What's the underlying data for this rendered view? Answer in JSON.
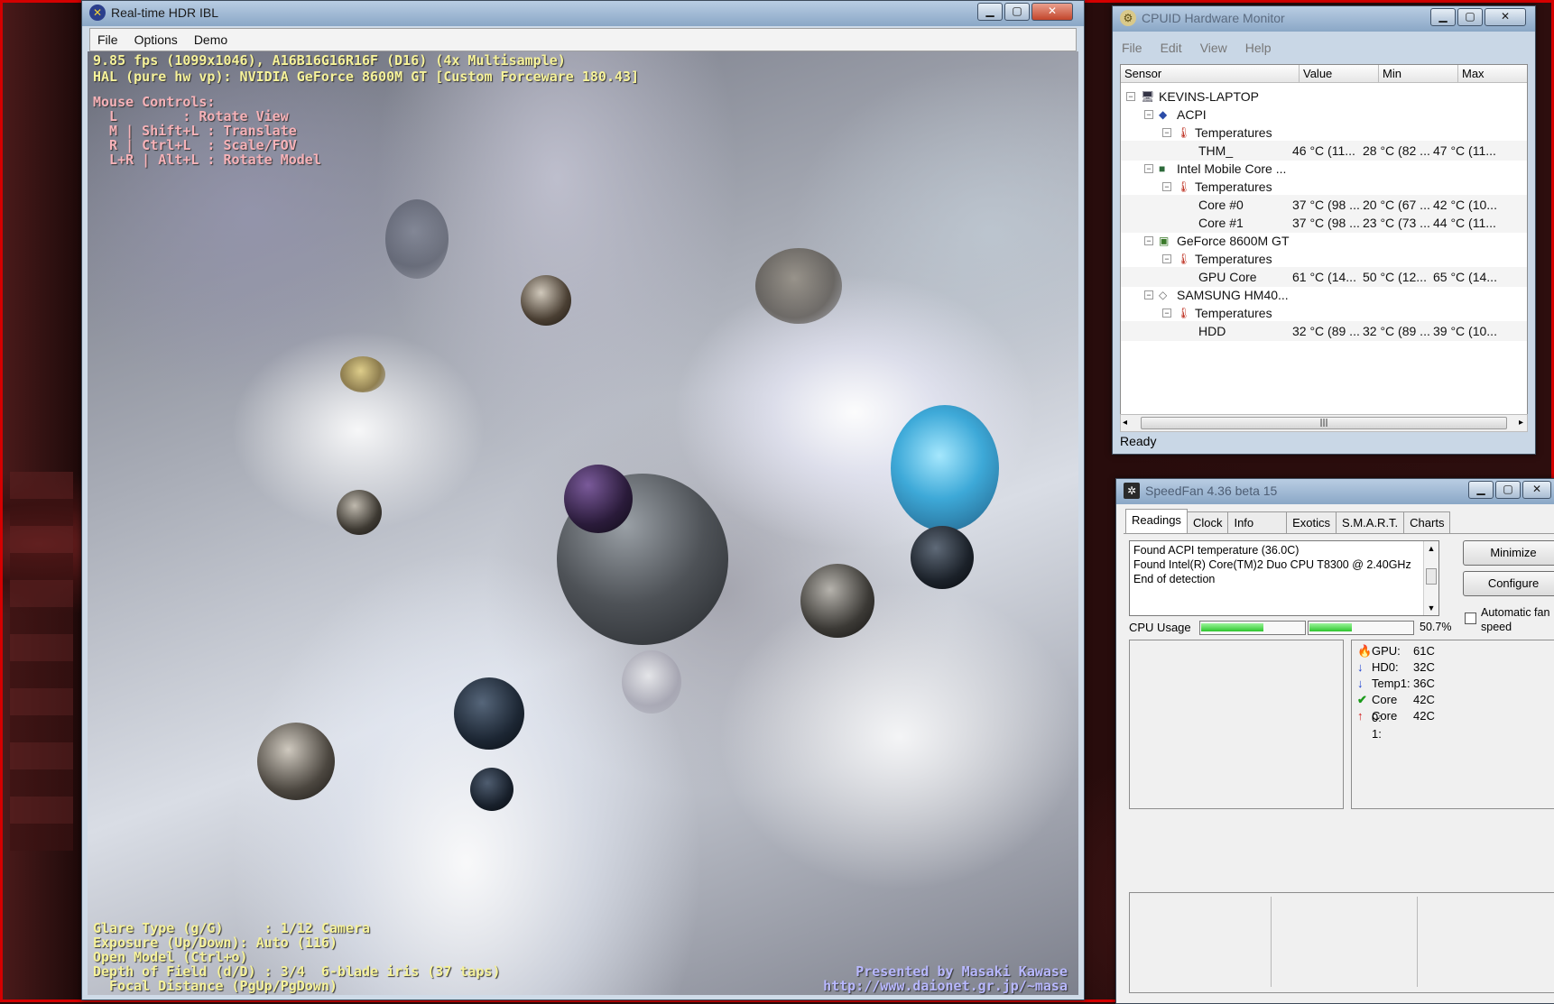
{
  "hdr": {
    "title": "Real-time HDR IBL",
    "menu": [
      "File",
      "Options",
      "Demo"
    ],
    "overlay_top": [
      "9.85 fps (1099x1046), A16B16G16R16F (D16) (4x Multisample)",
      "HAL (pure hw vp): NVIDIA GeForce 8600M GT [Custom Forceware 180.43]"
    ],
    "mouse_controls": [
      "Mouse Controls:",
      "  L        : Rotate View",
      "  M | Shift+L : Translate",
      "  R | Ctrl+L  : Scale/FOV",
      "  L+R | Alt+L : Rotate Model"
    ],
    "overlay_bottom": [
      "Glare Type (g/G)     : 1/12 Camera",
      "Exposure (Up/Down): Auto (116)",
      "Open Model (Ctrl+o)",
      "Depth of Field (d/D) : 3/4  6-blade iris (37 taps)",
      "  Focal Distance (PgUp/PgDown)"
    ],
    "credit": [
      "Presented by Masaki Kawase",
      "http://www.daionet.gr.jp/~masa"
    ]
  },
  "cpuid": {
    "title": "CPUID Hardware Monitor",
    "menu": [
      "File",
      "Edit",
      "View",
      "Help"
    ],
    "columns": [
      "Sensor",
      "Value",
      "Min",
      "Max"
    ],
    "rows": [
      {
        "level": 0,
        "toggle": "-",
        "icon": "computer-icon",
        "label": "KEVINS-LAPTOP",
        "value": "",
        "min": "",
        "max": ""
      },
      {
        "level": 1,
        "toggle": "-",
        "icon": "acpi-icon",
        "label": "ACPI",
        "value": "",
        "min": "",
        "max": ""
      },
      {
        "level": 2,
        "toggle": "-",
        "icon": "thermometer-icon",
        "label": "Temperatures",
        "value": "",
        "min": "",
        "max": ""
      },
      {
        "level": 3,
        "toggle": "",
        "icon": "",
        "label": "THM_",
        "value": "46 °C  (11...",
        "min": "28 °C  (82 ...",
        "max": "47 °C  (11..."
      },
      {
        "level": 1,
        "toggle": "-",
        "icon": "cpu-icon",
        "label": "Intel Mobile Core ...",
        "value": "",
        "min": "",
        "max": ""
      },
      {
        "level": 2,
        "toggle": "-",
        "icon": "thermometer-icon",
        "label": "Temperatures",
        "value": "",
        "min": "",
        "max": ""
      },
      {
        "level": 3,
        "toggle": "",
        "icon": "",
        "label": "Core #0",
        "value": "37 °C  (98 ...",
        "min": "20 °C  (67 ...",
        "max": "42 °C  (10..."
      },
      {
        "level": 3,
        "toggle": "",
        "icon": "",
        "label": "Core #1",
        "value": "37 °C  (98 ...",
        "min": "23 °C  (73 ...",
        "max": "44 °C  (11..."
      },
      {
        "level": 1,
        "toggle": "-",
        "icon": "gpu-icon",
        "label": "GeForce 8600M GT",
        "value": "",
        "min": "",
        "max": ""
      },
      {
        "level": 2,
        "toggle": "-",
        "icon": "thermometer-icon",
        "label": "Temperatures",
        "value": "",
        "min": "",
        "max": ""
      },
      {
        "level": 3,
        "toggle": "",
        "icon": "",
        "label": "GPU Core",
        "value": "61 °C  (14...",
        "min": "50 °C  (12...",
        "max": "65 °C  (14..."
      },
      {
        "level": 1,
        "toggle": "-",
        "icon": "hdd-icon",
        "label": "SAMSUNG HM40...",
        "value": "",
        "min": "",
        "max": ""
      },
      {
        "level": 2,
        "toggle": "-",
        "icon": "thermometer-icon",
        "label": "Temperatures",
        "value": "",
        "min": "",
        "max": ""
      },
      {
        "level": 3,
        "toggle": "",
        "icon": "",
        "label": "HDD",
        "value": "32 °C  (89 ...",
        "min": "32 °C  (89 ...",
        "max": "39 °C  (10..."
      }
    ],
    "status": "Ready"
  },
  "speedfan": {
    "title": "SpeedFan 4.36 beta 15",
    "tabs": [
      "Readings",
      "Clock",
      "Info",
      "Exotics",
      "S.M.A.R.T.",
      "Charts"
    ],
    "active_tab": 0,
    "log": [
      "Found ACPI temperature (36.0C)",
      "Found Intel(R) Core(TM)2 Duo CPU T8300 @ 2.40GHz",
      "End of detection"
    ],
    "minimize_label": "Minimize",
    "configure_label": "Configure",
    "auto_fan_label": "Automatic fan speed",
    "cpu_usage_label": "CPU Usage",
    "cpu_usage_value": "50.7%",
    "cpu_bars": [
      0.62,
      0.42
    ],
    "readings": [
      {
        "icon": "flame-icon",
        "label": "GPU:",
        "value": "61C"
      },
      {
        "icon": "arrow-down-icon",
        "label": "HD0:",
        "value": "32C"
      },
      {
        "icon": "arrow-down-icon",
        "label": "Temp1:",
        "value": "36C"
      },
      {
        "icon": "check-icon",
        "label": "Core 0:",
        "value": "42C"
      },
      {
        "icon": "arrow-up-icon",
        "label": "Core 1:",
        "value": "42C"
      }
    ]
  }
}
